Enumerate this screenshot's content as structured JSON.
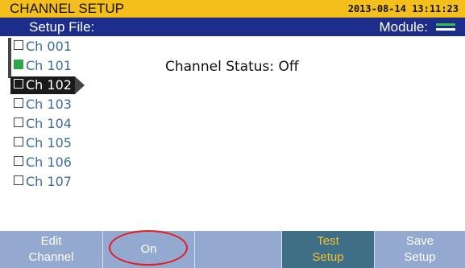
{
  "header": {
    "title": "CHANNEL SETUP",
    "datetime": "2013-08-14 13:11:23"
  },
  "infobar": {
    "setup_file_label": "Setup File:",
    "module_label": "Module:",
    "module_icon": "module-icon"
  },
  "channels": [
    {
      "label": "Ch 001",
      "enabled": false
    },
    {
      "label": "Ch 101",
      "enabled": true
    },
    {
      "label": "Ch 102",
      "enabled": false,
      "selected": true
    },
    {
      "label": "Ch 103",
      "enabled": false
    },
    {
      "label": "Ch 104",
      "enabled": false
    },
    {
      "label": "Ch 105",
      "enabled": false
    },
    {
      "label": "Ch 106",
      "enabled": false
    },
    {
      "label": "Ch 107",
      "enabled": false
    }
  ],
  "status": {
    "text": "Channel Status: Off"
  },
  "softkeys": [
    {
      "line1": "Edit",
      "line2": "Channel",
      "active": false
    },
    {
      "line1": "On",
      "line2": "",
      "active": false
    },
    {
      "line1": "",
      "line2": "",
      "active": false
    },
    {
      "line1": "Test",
      "line2": "Setup",
      "active": true
    },
    {
      "line1": "Save",
      "line2": "Setup",
      "active": false
    }
  ],
  "colors": {
    "title_bg": "#f4bf1d",
    "info_bg": "#1d2d8c",
    "softkey_bg": "#93a9cf",
    "softkey_active_bg": "#3f6f87",
    "channel_text": "#3d6c9b",
    "enabled_box": "#2ea64a",
    "highlight": "#e21e1e"
  }
}
